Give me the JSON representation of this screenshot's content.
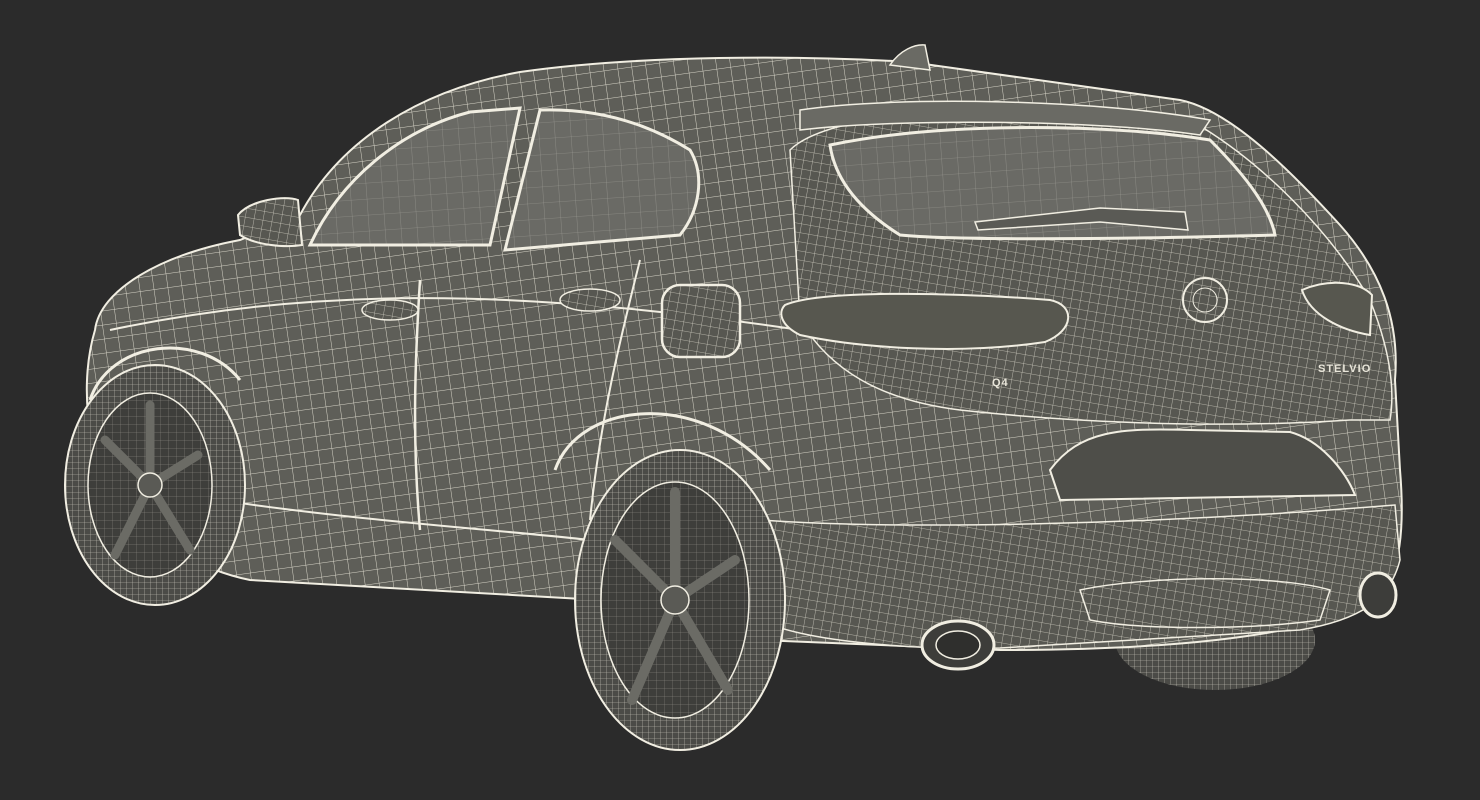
{
  "scene": {
    "subject": "wireframe-suv-rear-three-quarter",
    "background_color": "#2b2b2b",
    "wire_color": "#f1eee2",
    "shell_color": "#5c5c56",
    "glass_color": "#6b6b66",
    "tire_color": "#4a4a46"
  },
  "badges": {
    "model_badge": "STELVIO"
  }
}
